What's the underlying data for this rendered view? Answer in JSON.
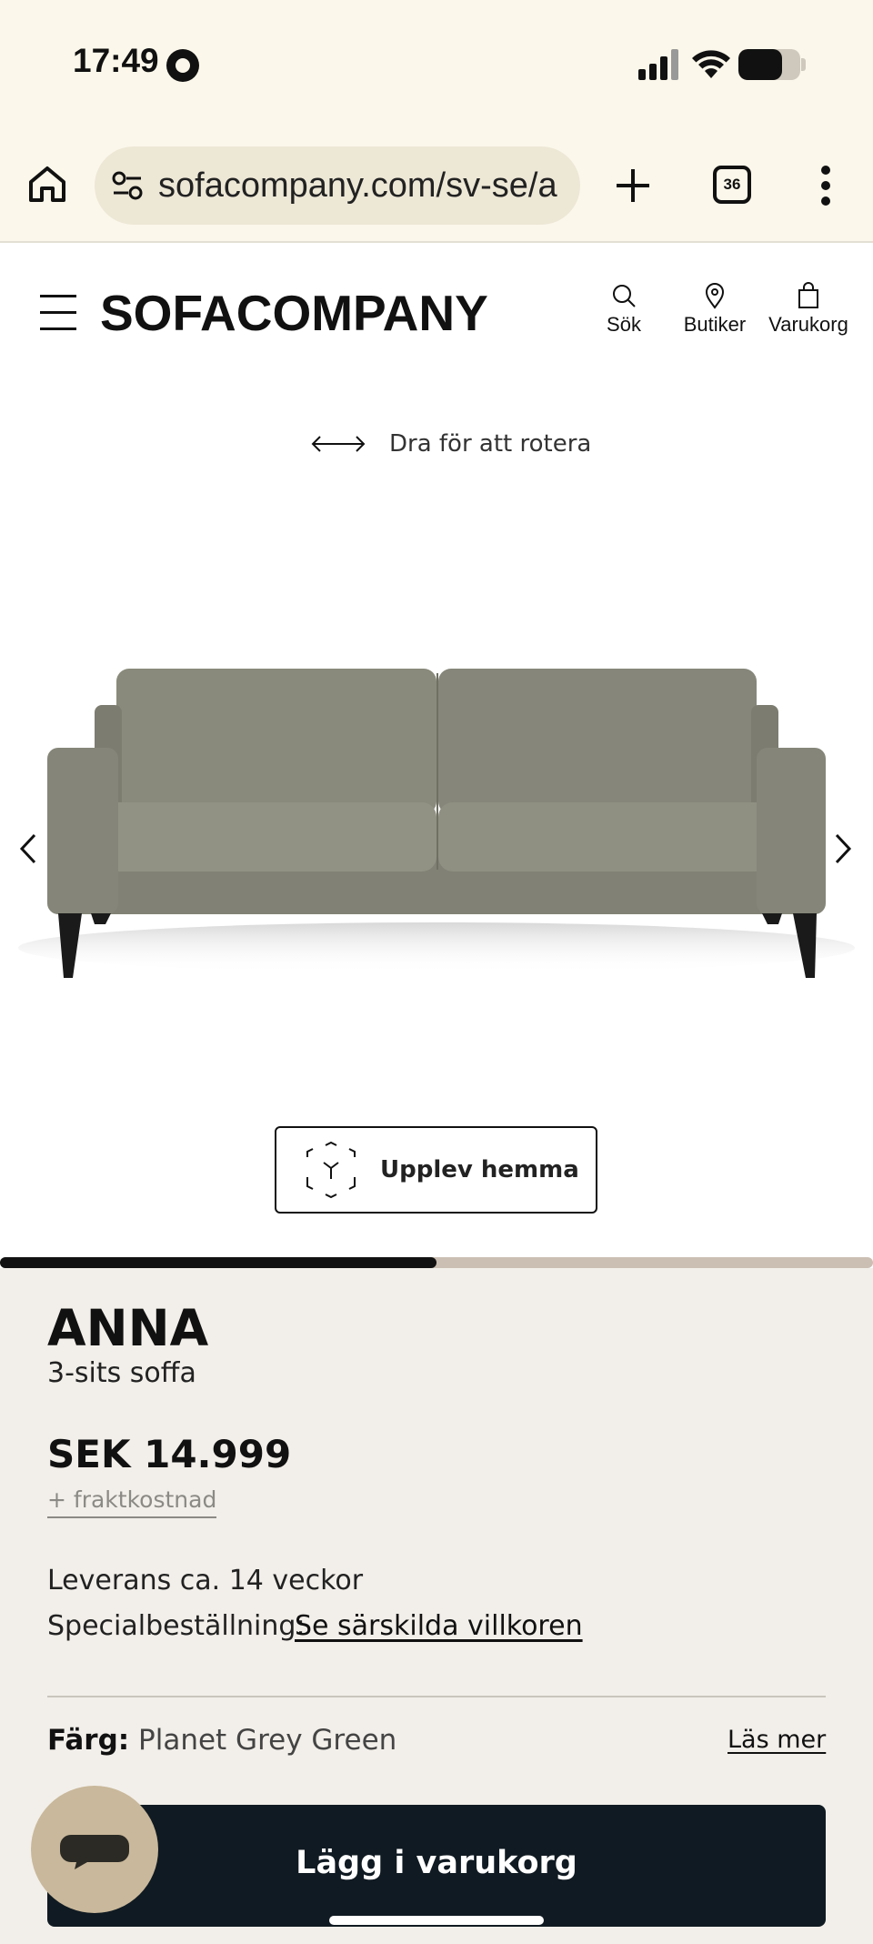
{
  "status_bar": {
    "time": "17:49",
    "battery_level": 0.7
  },
  "browser": {
    "url": "sofacompany.com/sv-se/a",
    "tab_count": "36",
    "icons": [
      "home-icon",
      "site-settings-icon",
      "plus-icon",
      "tabs-icon",
      "more-vert-icon"
    ]
  },
  "header": {
    "logo": "SOFACOMPANY",
    "nav": {
      "search": "Sök",
      "stores": "Butiker",
      "cart": "Varukorg"
    }
  },
  "viewer": {
    "rotate_hint": "Dra för att rotera",
    "ar_button": "Upplev hemma",
    "progress": 0.5
  },
  "product": {
    "name": "ANNA",
    "type": "3-sits soffa",
    "price": "SEK 14.999",
    "shipping": "+ fraktkostnad",
    "delivery": "Leverans ca. 14 veckor",
    "special_label": "Specialbeställning:",
    "special_link": "Se särskilda villkoren",
    "color_label": "Färg:",
    "color_value": "Planet Grey Green",
    "read_more": "Läs mer",
    "add_to_cart": "Lägg i varukorg"
  },
  "colors": {
    "browser_bg": "#fbf7ea",
    "info_bg": "#f2efea",
    "cart_button": "#101a22",
    "chat_button": "#c9b89b",
    "sofa": "#8a8a7c"
  }
}
